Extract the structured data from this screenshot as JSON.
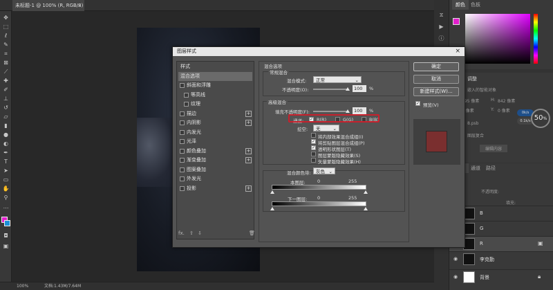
{
  "doc_tab": {
    "title": "未标题-1 @ 100% (R, RGB/8) *",
    "close": "×"
  },
  "status": {
    "zoom": "100%",
    "doc_size": "文档:1.43M/7.64M"
  },
  "right_panels": {
    "color_tabs": [
      "颜色",
      "色板"
    ],
    "props_title": "调整",
    "props_sub": "嵌入的智能对象",
    "props_w_label": "W:",
    "props_w": "595 像素",
    "props_h_label": "H:",
    "props_h": "842 像素",
    "props_x_label": "X:",
    "props_x": "0 像素",
    "props_y_label": "Y:",
    "props_y": "0 像素",
    "props_file": "8.psb",
    "props_edit": "编辑内容",
    "props_lower": "图层复合",
    "bubble_pct": "50",
    "bubble_small1": "0k/s",
    "bubble_small2": "0.1k/s",
    "layer_tabs": [
      "图层",
      "通道",
      "路径"
    ],
    "opacity_label": "不透明度:",
    "fill_label": "填充:",
    "layers": [
      {
        "name": "B"
      },
      {
        "name": "G"
      },
      {
        "name": "R"
      },
      {
        "name": "李克勤"
      },
      {
        "name": "背景"
      }
    ]
  },
  "dialog": {
    "title": "图层样式",
    "close": "×",
    "styles": [
      {
        "label": "样式",
        "checkbox": false,
        "plus": false
      },
      {
        "label": "混合选项",
        "checkbox": false,
        "plus": false,
        "selected": true
      },
      {
        "label": "斜面和浮雕",
        "checkbox": true,
        "plus": false
      },
      {
        "label": "等高线",
        "checkbox": true,
        "plus": false,
        "indent": true
      },
      {
        "label": "纹理",
        "checkbox": true,
        "plus": false,
        "indent": true
      },
      {
        "label": "描边",
        "checkbox": true,
        "plus": true
      },
      {
        "label": "内阴影",
        "checkbox": true,
        "plus": true
      },
      {
        "label": "内发光",
        "checkbox": true,
        "plus": false
      },
      {
        "label": "光泽",
        "checkbox": true,
        "plus": false
      },
      {
        "label": "颜色叠加",
        "checkbox": true,
        "plus": true
      },
      {
        "label": "渐变叠加",
        "checkbox": true,
        "plus": true
      },
      {
        "label": "图案叠加",
        "checkbox": true,
        "plus": false
      },
      {
        "label": "外发光",
        "checkbox": true,
        "plus": false
      },
      {
        "label": "投影",
        "checkbox": true,
        "plus": true
      }
    ],
    "fx_label": "fx.",
    "section_title": "混合选项",
    "normal_blend": {
      "title": "常规混合",
      "mode_label": "混合模式:",
      "mode_value": "正常",
      "opacity_label": "不透明度(O):",
      "opacity_value": "100",
      "opacity_unit": "%"
    },
    "advanced_blend": {
      "title": "高级混合",
      "fill_label": "填充不透明度(F):",
      "fill_value": "100",
      "fill_unit": "%",
      "channels_label": "通道:",
      "channel_r": "R(R)",
      "channel_g": "G(G)",
      "channel_b": "B(B)",
      "knockout_label": "挖空:",
      "knockout_value": "无",
      "options": [
        {
          "label": "将内部效果混合成组(I)",
          "checked": false
        },
        {
          "label": "将剪贴图层混合成组(P)",
          "checked": true
        },
        {
          "label": "透明形状图层(T)",
          "checked": true
        },
        {
          "label": "图层蒙版隐藏效果(S)",
          "checked": false
        },
        {
          "label": "矢量蒙版隐藏效果(H)",
          "checked": false
        }
      ]
    },
    "blend_if": {
      "label": "混合颜色带:",
      "value": "灰色",
      "this_layer_label": "本图层:",
      "this_layer_min": "0",
      "this_layer_max": "255",
      "under_layer_label": "下一图层:",
      "under_layer_min": "0",
      "under_layer_max": "255"
    },
    "buttons": {
      "ok": "确定",
      "cancel": "取消",
      "new_style": "新建样式(W)...",
      "preview": "预览(V)"
    }
  }
}
